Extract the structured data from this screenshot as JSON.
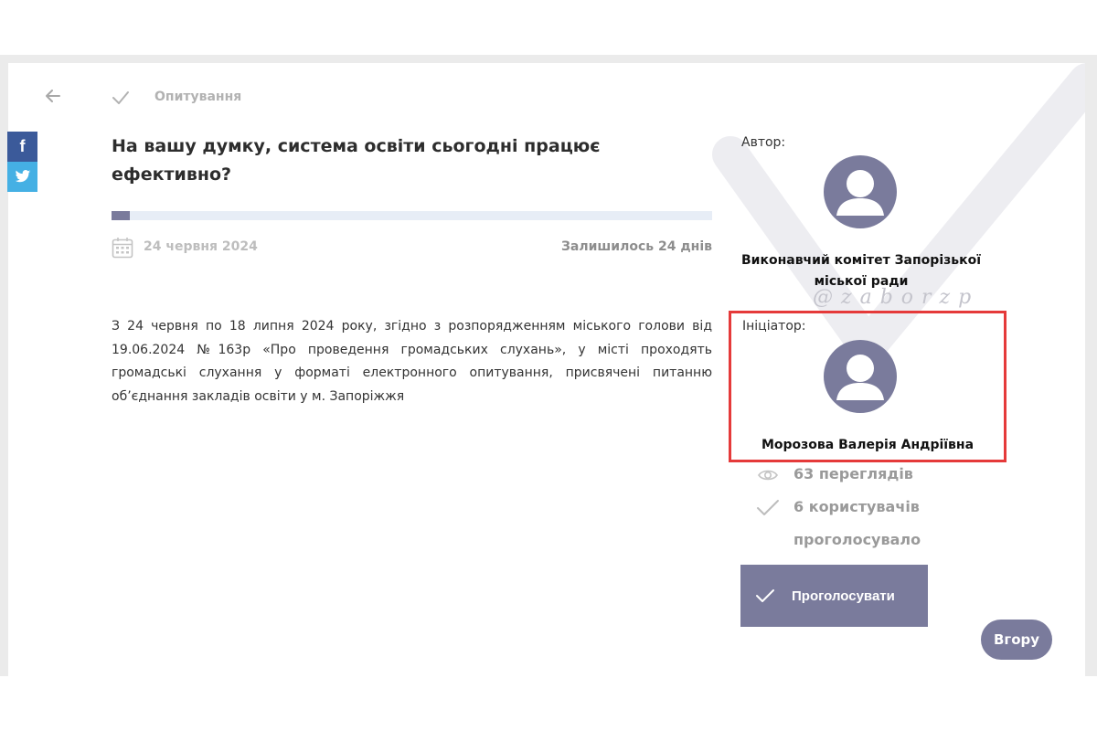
{
  "breadcrumb": {
    "section": "Опитування"
  },
  "poll": {
    "title": "На вашу думку, система освіти сьогодні працює ефективно?",
    "progress_fraction": 0.03,
    "date": "24 червня 2024",
    "remaining": "Залишилось 24 днів",
    "description": "З 24 червня по 18 липня 2024 року, згідно з розпорядженням міського голови від 19.06.2024 №163р «Про проведення громадських слухань», у місті проходять громадські слухання у форматі електронного опитування, присвячені питанню об’єднання закладів освіти у м. Запоріжжя"
  },
  "share": {
    "facebook_icon": "f",
    "twitter_icon": "twitter-bird"
  },
  "sidebar": {
    "author_label": "Автор:",
    "author_name": "Виконавчий комітет Запорізької міської ради",
    "initiator_label": "Ініціатор:",
    "initiator_name": "Морозова Валерія Андріївна",
    "views": "63 переглядів",
    "votes": "6 користувачів проголосувало",
    "vote_button_label": "Проголосувати"
  },
  "watermark": "@zaborzp",
  "top_button_label": "Вгору",
  "colors": {
    "accent": "#7a7b9c",
    "progress_track": "#e7edf6",
    "highlight": "#e53a3a",
    "facebook": "#3b5a9a",
    "twitter": "#45b0e4"
  }
}
